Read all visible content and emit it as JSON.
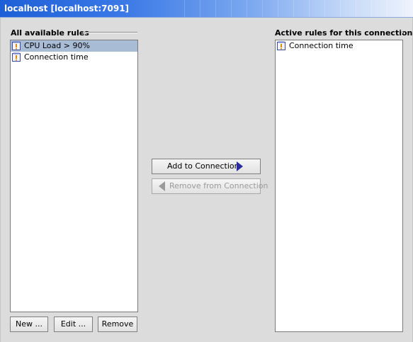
{
  "window": {
    "title": "localhost [localhost:7091]"
  },
  "available": {
    "label": "All available rules",
    "items": [
      {
        "label": "CPU Load > 90%",
        "selected": true
      },
      {
        "label": "Connection time",
        "selected": false
      }
    ]
  },
  "active": {
    "label": "Active rules for this connection",
    "items": [
      {
        "label": "Connection time"
      }
    ]
  },
  "actions": {
    "add_label": "Add to Connection",
    "remove_label": "Remove from Connection"
  },
  "list_buttons": {
    "new_label": "New ...",
    "edit_label": "Edit ...",
    "remove_label": "Remove"
  },
  "icons": {
    "rule_item": "rule-alert-icon",
    "add_arrow": "arrow-right-icon",
    "remove_arrow": "arrow-left-icon"
  },
  "colors": {
    "title_bar": "#1d5fd7",
    "selection": "#a9bcd6",
    "add_arrow": "#2c2ca0"
  }
}
